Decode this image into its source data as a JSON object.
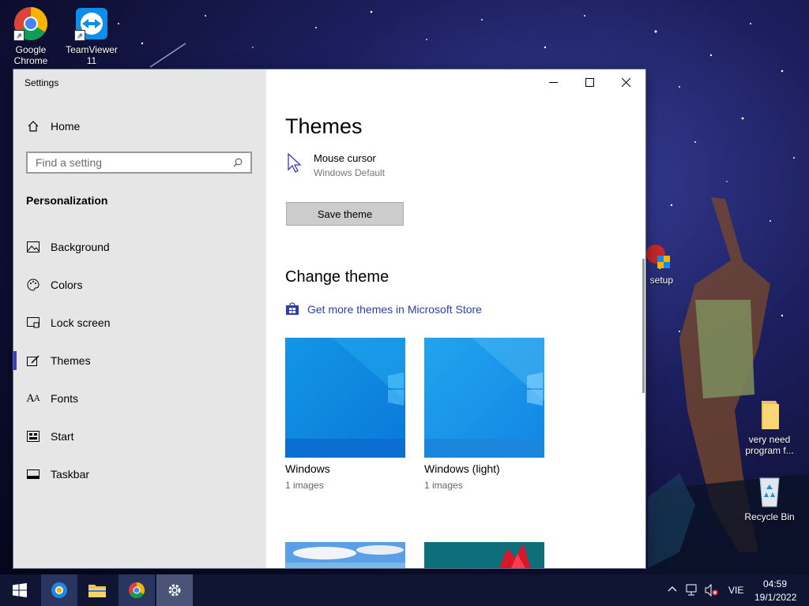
{
  "desktop": {
    "icons": [
      {
        "label": "Google\nChrome",
        "line1": "Google",
        "line2": "Chrome"
      },
      {
        "label": "TeamViewer 11",
        "line1": "TeamViewer",
        "line2": "11"
      },
      {
        "line1": "setup"
      },
      {
        "line1": "very need",
        "line2": "program f..."
      },
      {
        "line1": "Recycle Bin"
      }
    ]
  },
  "window": {
    "title": "Settings",
    "controls": {
      "minimize": "—",
      "maximize": "☐",
      "close": "✕"
    }
  },
  "sidebar": {
    "home_label": "Home",
    "search_placeholder": "Find a setting",
    "section_label": "Personalization",
    "items": [
      {
        "label": "Background",
        "icon": "background-icon"
      },
      {
        "label": "Colors",
        "icon": "palette-icon"
      },
      {
        "label": "Lock screen",
        "icon": "lock-screen-icon"
      },
      {
        "label": "Themes",
        "icon": "themes-icon",
        "active": true
      },
      {
        "label": "Fonts",
        "icon": "fonts-icon"
      },
      {
        "label": "Start",
        "icon": "start-icon"
      },
      {
        "label": "Taskbar",
        "icon": "taskbar-icon"
      }
    ]
  },
  "main": {
    "title": "Themes",
    "cursor_setting": {
      "label": "Mouse cursor",
      "value": "Windows Default"
    },
    "save_button": "Save theme",
    "change_theme_heading": "Change theme",
    "store_link": "Get more themes in Microsoft Store",
    "themes": [
      {
        "name": "Windows",
        "count": "1 images"
      },
      {
        "name": "Windows (light)",
        "count": "1 images"
      }
    ]
  },
  "taskbar": {
    "language": "VIE",
    "time": "04:59",
    "date": "19/1/2022"
  },
  "colors": {
    "accent": "#3c3cc4",
    "link": "#2b3fa8",
    "sidebar_bg": "#e6e6e6",
    "taskbar_bg": "#0f1533"
  }
}
